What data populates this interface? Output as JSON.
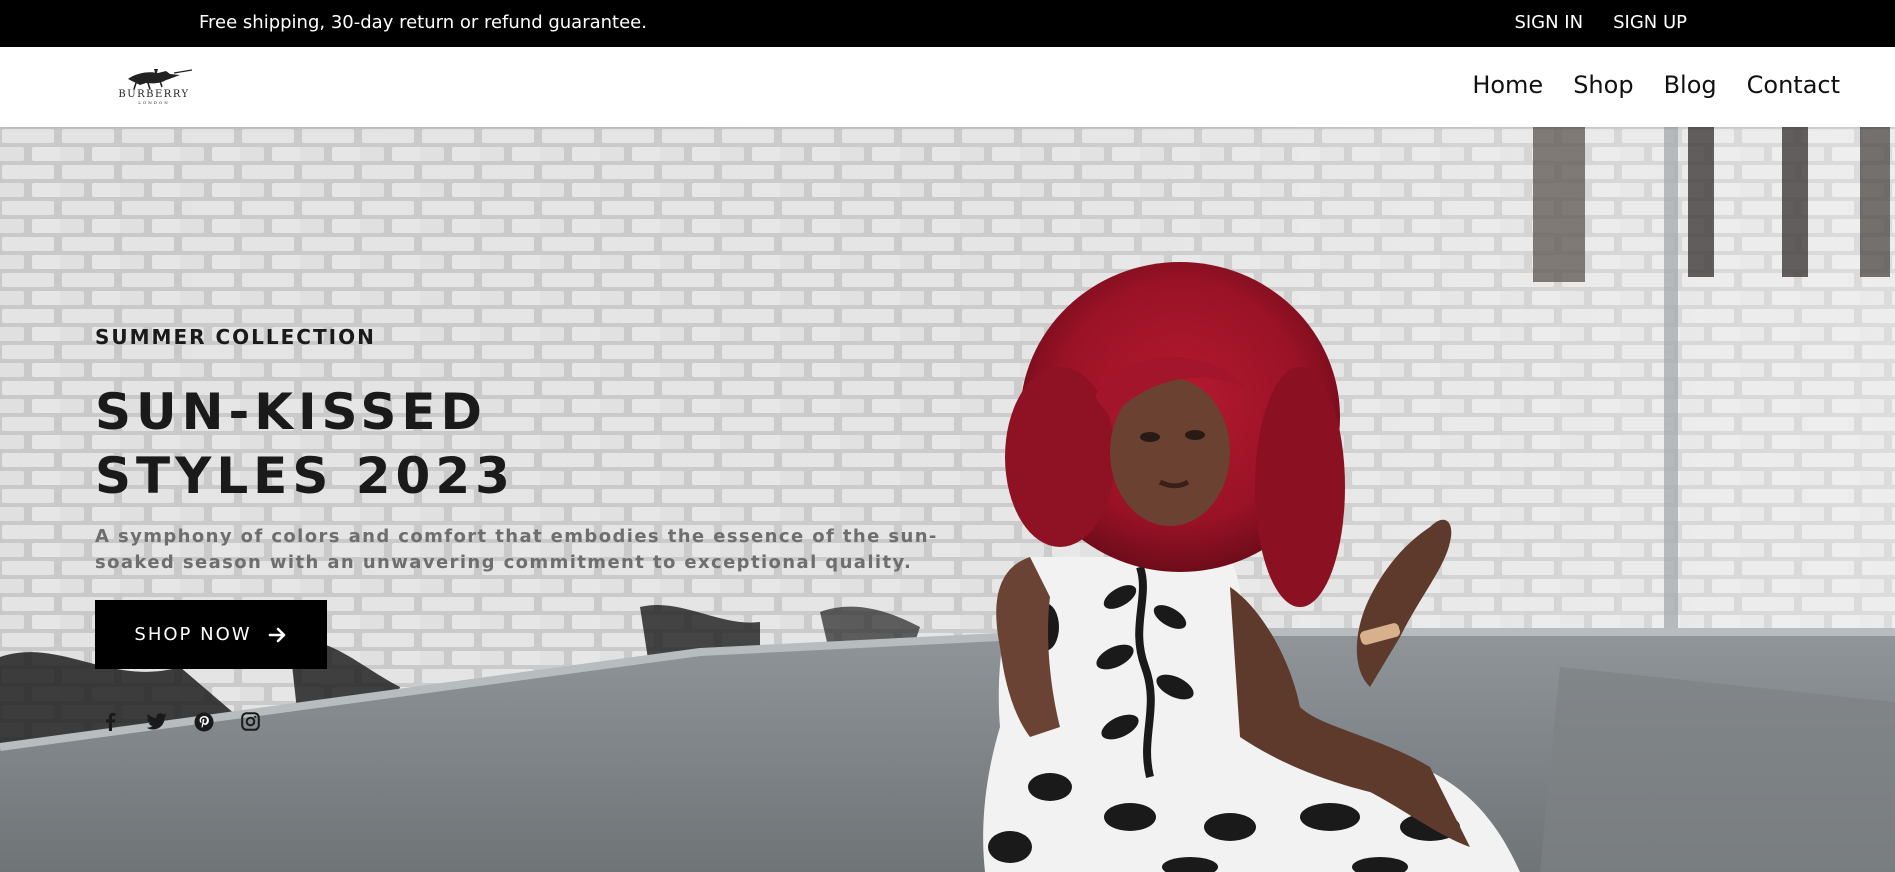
{
  "topbar": {
    "message": "Free shipping, 30-day return or refund guarantee.",
    "sign_in": "SIGN IN",
    "sign_up": "SIGN UP"
  },
  "header": {
    "logo_text": "BURBERRY",
    "logo_subtext": "LONDON",
    "logo_icon": "horse-knight-logo-icon",
    "nav": [
      "Home",
      "Shop",
      "Blog",
      "Contact"
    ]
  },
  "hero": {
    "eyebrow": "SUMMER COLLECTION",
    "title_line1": "SUN-KISSED",
    "title_line2": "STYLES 2023",
    "subtitle": "A symphony of colors and comfort that embodies the essence of the sun-soaked season with an unwavering commitment to exceptional quality.",
    "cta_label": "SHOP NOW",
    "cta_icon": "arrow-right-icon",
    "socials": [
      "facebook-icon",
      "twitter-icon",
      "pinterest-icon",
      "instagram-icon"
    ]
  },
  "colors": {
    "topbar_bg": "#000000",
    "cta_bg": "#000000",
    "subtitle_gray": "#6e6e6e",
    "hair_red": "#9e1428"
  }
}
